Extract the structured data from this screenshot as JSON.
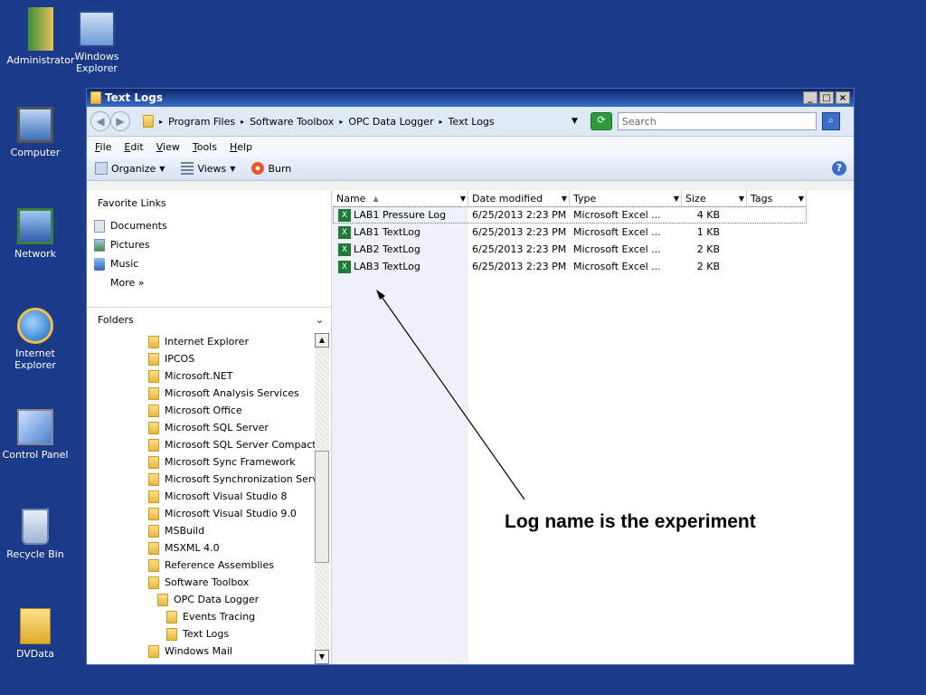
{
  "desktop": {
    "icons": [
      {
        "label": "Administrator",
        "icon": "user-folder-icon"
      },
      {
        "label": "Windows Explorer",
        "icon": "explorer-shortcut-icon"
      },
      {
        "label": "Computer",
        "icon": "computer-icon"
      },
      {
        "label": "Network",
        "icon": "network-icon"
      },
      {
        "label": "Internet Explorer",
        "icon": "ie-icon"
      },
      {
        "label": "Control Panel",
        "icon": "control-panel-icon"
      },
      {
        "label": "Recycle Bin",
        "icon": "recycle-bin-icon"
      },
      {
        "label": "DVData",
        "icon": "folder-icon"
      }
    ]
  },
  "window": {
    "title": "Text Logs",
    "controls": [
      "_",
      "□",
      "×"
    ]
  },
  "address": {
    "crumbs": [
      "Program Files",
      "Software Toolbox",
      "OPC Data Logger",
      "Text Logs"
    ],
    "search_placeholder": "Search"
  },
  "menu": [
    "File",
    "Edit",
    "View",
    "Tools",
    "Help"
  ],
  "toolbar": {
    "organize": "Organize",
    "views": "Views",
    "burn": "Burn"
  },
  "favorites": {
    "header": "Favorite Links",
    "items": [
      "Documents",
      "Pictures",
      "Music"
    ],
    "more": "More  »"
  },
  "folders": {
    "header": "Folders",
    "items": [
      {
        "label": "Internet Explorer",
        "level": 1
      },
      {
        "label": "IPCOS",
        "level": 1
      },
      {
        "label": "Microsoft.NET",
        "level": 1
      },
      {
        "label": "Microsoft Analysis Services",
        "level": 1
      },
      {
        "label": "Microsoft Office",
        "level": 1
      },
      {
        "label": "Microsoft SQL Server",
        "level": 1
      },
      {
        "label": "Microsoft SQL Server Compact E",
        "level": 1
      },
      {
        "label": "Microsoft Sync Framework",
        "level": 1
      },
      {
        "label": "Microsoft Synchronization Servi",
        "level": 1
      },
      {
        "label": "Microsoft Visual Studio 8",
        "level": 1
      },
      {
        "label": "Microsoft Visual Studio 9.0",
        "level": 1
      },
      {
        "label": "MSBuild",
        "level": 1
      },
      {
        "label": "MSXML 4.0",
        "level": 1
      },
      {
        "label": "Reference Assemblies",
        "level": 1
      },
      {
        "label": "Software Toolbox",
        "level": 1
      },
      {
        "label": "OPC Data Logger",
        "level": 2
      },
      {
        "label": "Events Tracing",
        "level": 3
      },
      {
        "label": "Text Logs",
        "level": 3
      },
      {
        "label": "Windows Mail",
        "level": 1
      }
    ]
  },
  "columns": [
    "Name",
    "Date modified",
    "Type",
    "Size",
    "Tags"
  ],
  "files": [
    {
      "name": "LAB1 Pressure Log",
      "modified": "6/25/2013 2:23 PM",
      "type": "Microsoft Excel ...",
      "size": "4 KB",
      "selected": true
    },
    {
      "name": "LAB1 TextLog",
      "modified": "6/25/2013 2:23 PM",
      "type": "Microsoft Excel ...",
      "size": "1 KB",
      "selected": false
    },
    {
      "name": "LAB2 TextLog",
      "modified": "6/25/2013 2:23 PM",
      "type": "Microsoft Excel ...",
      "size": "2 KB",
      "selected": false
    },
    {
      "name": "LAB3 TextLog",
      "modified": "6/25/2013 2:23 PM",
      "type": "Microsoft Excel ...",
      "size": "2 KB",
      "selected": false
    }
  ],
  "annotation": "Log name is the experiment",
  "colors": {
    "desktop": "#1b3a8a",
    "titlebar": "#0a246a",
    "excel": "#1e7a35"
  }
}
